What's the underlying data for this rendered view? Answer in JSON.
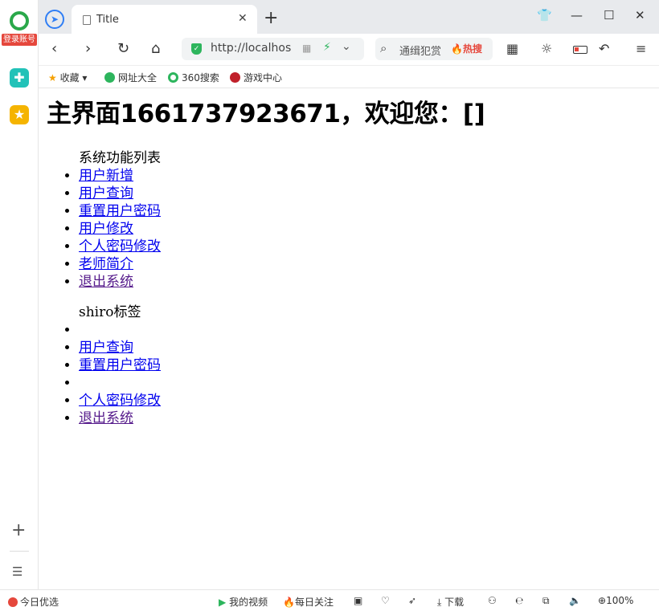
{
  "browser": {
    "sidebar_login": "登录账号",
    "tab_title": "Title",
    "url": "http://localhos",
    "search_query": "通缉犯赏",
    "search_hot": "🔥热搜",
    "bookmarks": [
      {
        "label": "收藏",
        "icon": "star-icon"
      },
      {
        "label": "网址大全",
        "icon": "globe-icon"
      },
      {
        "label": "360搜索",
        "icon": "360-icon"
      },
      {
        "label": "游戏中心",
        "icon": "game-icon"
      }
    ]
  },
  "page": {
    "heading": "主界面1661737923671，欢迎您：[]",
    "section1_title": "系统功能列表",
    "section1_items": [
      "用户新增",
      "用户查询",
      "重置用户密码",
      "用户修改",
      "个人密码修改",
      "老师简介",
      "退出系统"
    ],
    "section2_title": "shiro标签",
    "section2_items": [
      "",
      "用户查询",
      "重置用户密码",
      "",
      "个人密码修改",
      "退出系统"
    ]
  },
  "statusbar": {
    "left": "今日优选",
    "video": "我的视频",
    "follow": "每日关注",
    "download": "下载",
    "zoom": "100%"
  }
}
